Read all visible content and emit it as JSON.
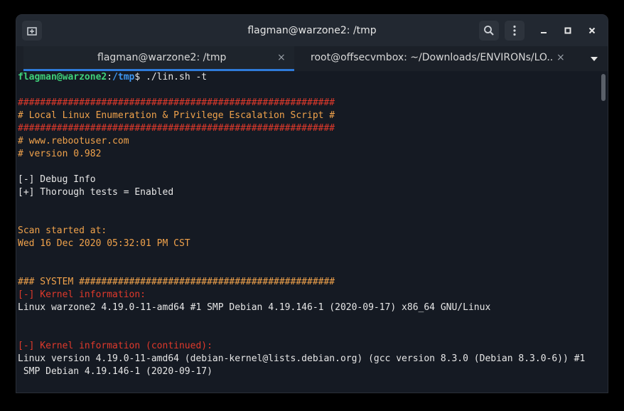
{
  "window": {
    "title": "flagman@warzone2: /tmp"
  },
  "tabs": [
    {
      "label": "flagman@warzone2: /tmp",
      "close": "×",
      "active": true
    },
    {
      "label": "root@offsecvmbox: ~/Downloads/ENVIRONs/LO...",
      "close": "×",
      "active": false
    }
  ],
  "icons": {
    "new_tab": "new-tab-icon",
    "search": "search-icon",
    "menu": "kebab-menu-icon",
    "minimize": "minimize-icon",
    "maximize": "maximize-icon",
    "close": "close-icon",
    "tab_list": "chevron-down-icon"
  },
  "prompt": {
    "user_host": "flagman@warzone2",
    "colon": ":",
    "path": "/tmp",
    "symbol": "$",
    "command": " ./lin.sh -t"
  },
  "output": {
    "hash_line": "#########################################################",
    "script_title": "# Local Linux Enumeration & Privilege Escalation Script #",
    "website": "# www.rebootuser.com",
    "version": "# version 0.982",
    "debug_info": "[-] Debug Info",
    "thorough": "[+] Thorough tests = Enabled",
    "scan_started": "Scan started at:",
    "scan_date": "Wed 16 Dec 2020 05:32:01 PM CST",
    "system_header": "### SYSTEM ##############################################",
    "kernel_info": "[-] Kernel information:",
    "kernel_value": "Linux warzone2 4.19.0-11-amd64 #1 SMP Debian 4.19.146-1 (2020-09-17) x86_64 GNU/Linux",
    "kernel_cont": "[-] Kernel information (continued):",
    "kernel_cont_value1": "Linux version 4.19.0-11-amd64 (debian-kernel@lists.debian.org) (gcc version 8.3.0 (Debian 8.3.0-6)) #1",
    "kernel_cont_value2": " SMP Debian 4.19.146-1 (2020-09-17)"
  },
  "colors": {
    "background": "#151a23",
    "red": "#e0392b",
    "orange": "#f0a24b",
    "green": "#3fd17a",
    "blue": "#3e96f0",
    "tab_accent": "#2f7bd9"
  }
}
